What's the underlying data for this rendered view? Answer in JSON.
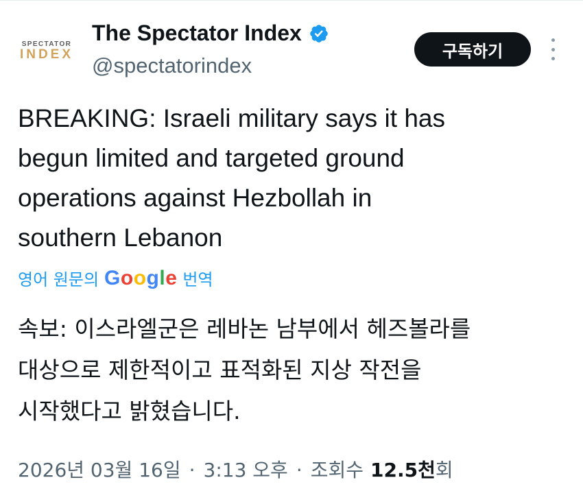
{
  "author": {
    "avatar_line1": "SPECTATOR",
    "avatar_line2": "INDEX",
    "display_name": "The Spectator Index",
    "handle": "@spectatorindex",
    "verified_color": "#1d9bf0"
  },
  "actions": {
    "subscribe_label": "구독하기",
    "more_icon": "more-vertical-icon"
  },
  "tweet": {
    "lines": [
      "BREAKING: Israeli military says it has",
      "begun limited and targeted ground",
      "operations against Hezbollah in",
      "southern Lebanon"
    ]
  },
  "translate": {
    "lead": "영어 원문의",
    "brand_letters": [
      "G",
      "o",
      "o",
      "g",
      "l",
      "e"
    ],
    "tail": "번역"
  },
  "translation": {
    "lines": [
      "속보: 이스라엘군은 레바논 남부에서 헤즈볼라를",
      "대상으로 제한적이고 표적화된 지상 작전을",
      "시작했다고 밝혔습니다."
    ]
  },
  "meta": {
    "date": "2026년 03월 16일",
    "separator": "·",
    "time": "3:13 오후",
    "views_label": "조회수",
    "views_count": "12.5천",
    "views_suffix": "회"
  },
  "colors": {
    "accent": "#1d9bf0",
    "text": "#0f1419",
    "muted": "#536471"
  }
}
